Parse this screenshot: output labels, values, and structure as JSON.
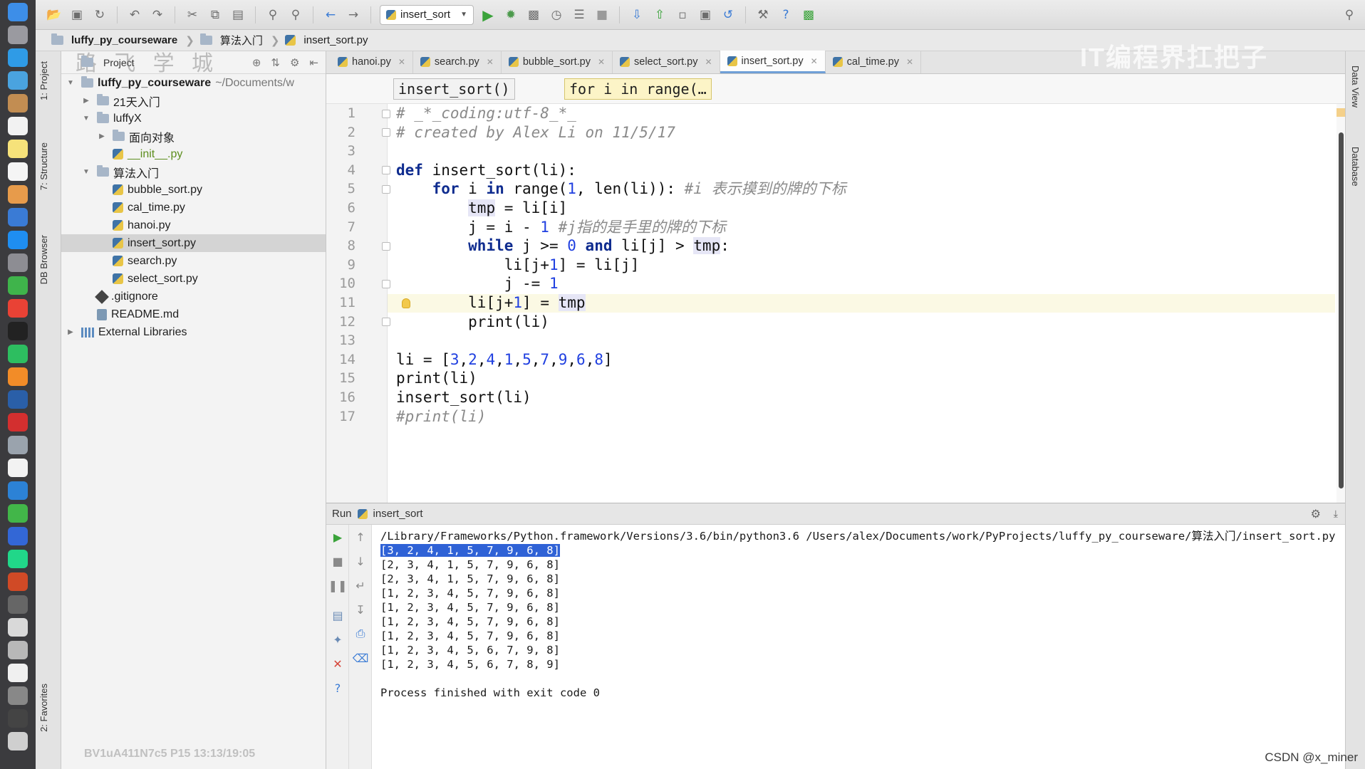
{
  "toolbar": {
    "run_config": "insert_sort"
  },
  "navbar": {
    "crumbs": [
      "luffy_py_courseware",
      "算法入门",
      "insert_sort.py"
    ]
  },
  "left_stripe": {
    "tabs": [
      "1: Project",
      "7: Structure",
      "DB Browser",
      "2: Favorites"
    ]
  },
  "right_stripe": {
    "tabs": [
      "Data View",
      "Database"
    ]
  },
  "project": {
    "header": "Project",
    "watermark": "路 飞 学 城",
    "root_name": "luffy_py_courseware",
    "root_path": "~/Documents/w",
    "items": [
      {
        "label": "21天入门"
      },
      {
        "label": "luffyX"
      },
      {
        "label": "面向对象"
      },
      {
        "label": "__init__.py"
      },
      {
        "label": "算法入门"
      },
      {
        "label": "bubble_sort.py"
      },
      {
        "label": "cal_time.py"
      },
      {
        "label": "hanoi.py"
      },
      {
        "label": "insert_sort.py"
      },
      {
        "label": "search.py"
      },
      {
        "label": "select_sort.py"
      },
      {
        "label": ".gitignore"
      },
      {
        "label": "README.md"
      },
      {
        "label": "External Libraries"
      }
    ],
    "bottom_watermark": "BV1uA411N7c5 P15 13:13/19:05"
  },
  "editor": {
    "tabs": [
      {
        "label": "hanoi.py"
      },
      {
        "label": "search.py"
      },
      {
        "label": "bubble_sort.py"
      },
      {
        "label": "select_sort.py"
      },
      {
        "label": "insert_sort.py"
      },
      {
        "label": "cal_time.py"
      }
    ],
    "code_crumbs": [
      "insert_sort()",
      "for i in range(…"
    ],
    "line_numbers": [
      "1",
      "2",
      "3",
      "4",
      "5",
      "6",
      "7",
      "8",
      "9",
      "10",
      "11",
      "12",
      "13",
      "14",
      "15",
      "16",
      "17"
    ],
    "lines": [
      {
        "text": "# _*_coding:utf-8_*_"
      },
      {
        "text": "# created by Alex Li on 11/5/17"
      },
      {
        "text": ""
      },
      {
        "text": "def insert_sort(li):"
      },
      {
        "text": "    for i in range(1, len(li)): #i 表示摸到的牌的下标"
      },
      {
        "text": "        tmp = li[i]"
      },
      {
        "text": "        j = i - 1 #j指的是手里的牌的下标"
      },
      {
        "text": "        while j >= 0 and li[j] > tmp:"
      },
      {
        "text": "            li[j+1] = li[j]"
      },
      {
        "text": "            j -= 1"
      },
      {
        "text": "        li[j+1] = tmp"
      },
      {
        "text": "        print(li)"
      },
      {
        "text": ""
      },
      {
        "text": "li = [3,2,4,1,5,7,9,6,8]"
      },
      {
        "text": "print(li)"
      },
      {
        "text": "insert_sort(li)"
      },
      {
        "text": "#print(li)"
      }
    ]
  },
  "run": {
    "label": "Run",
    "config": "insert_sort",
    "command": "/Library/Frameworks/Python.framework/Versions/3.6/bin/python3.6 /Users/alex/Documents/work/PyProjects/luffy_py_courseware/算法入门/insert_sort.py",
    "output": [
      "[3, 2, 4, 1, 5, 7, 9, 6, 8]",
      "[2, 3, 4, 1, 5, 7, 9, 6, 8]",
      "[2, 3, 4, 1, 5, 7, 9, 6, 8]",
      "[1, 2, 3, 4, 5, 7, 9, 6, 8]",
      "[1, 2, 3, 4, 5, 7, 9, 6, 8]",
      "[1, 2, 3, 4, 5, 7, 9, 6, 8]",
      "[1, 2, 3, 4, 5, 7, 9, 6, 8]",
      "[1, 2, 3, 4, 5, 6, 7, 9, 8]",
      "[1, 2, 3, 4, 5, 6, 7, 8, 9]"
    ],
    "finish": "Process finished with exit code 0"
  },
  "watermarks": {
    "brand": "IT编程界扛把子",
    "csdn": "CSDN @x_miner"
  },
  "colors": {
    "keyword": "#0f2c8f",
    "number": "#1f3fe0",
    "comment": "#8a8a8a",
    "selection": "#2f62d6",
    "current_line": "#fbf9e4"
  }
}
